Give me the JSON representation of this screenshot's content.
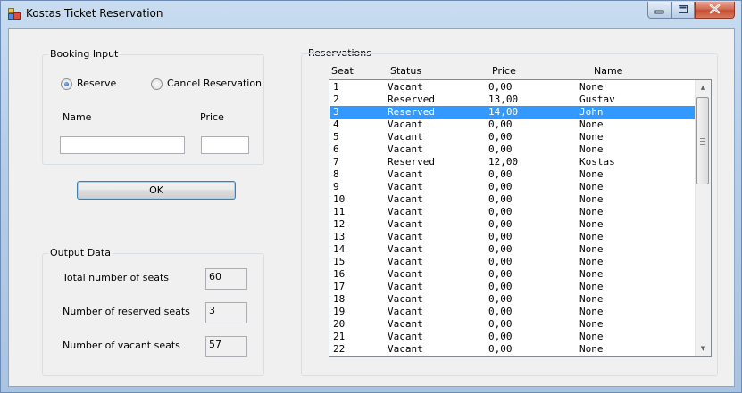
{
  "window": {
    "title": "Kostas Ticket Reservation"
  },
  "booking": {
    "group_title": "Booking Input",
    "reserve_label": "Reserve",
    "cancel_label": "Cancel Reservation",
    "selected_option": "Reserve",
    "name_label": "Name",
    "price_label": "Price",
    "name_value": "",
    "price_value": ""
  },
  "ok_label": "OK",
  "output": {
    "group_title": "Output Data",
    "total_label": "Total number of seats",
    "total_value": "60",
    "reserved_label": "Number of reserved seats",
    "reserved_value": "3",
    "vacant_label": "Number of vacant seats",
    "vacant_value": "57"
  },
  "reservations": {
    "group_title": "Reservations",
    "columns": [
      "Seat",
      "Status",
      "Price",
      "Name"
    ],
    "selected_seat": "3",
    "rows": [
      {
        "seat": "1",
        "status": "Vacant",
        "price": "0,00",
        "name": "None"
      },
      {
        "seat": "2",
        "status": "Reserved",
        "price": "13,00",
        "name": "Gustav"
      },
      {
        "seat": "3",
        "status": "Reserved",
        "price": "14,00",
        "name": "John"
      },
      {
        "seat": "4",
        "status": "Vacant",
        "price": "0,00",
        "name": "None"
      },
      {
        "seat": "5",
        "status": "Vacant",
        "price": "0,00",
        "name": "None"
      },
      {
        "seat": "6",
        "status": "Vacant",
        "price": "0,00",
        "name": "None"
      },
      {
        "seat": "7",
        "status": "Reserved",
        "price": "12,00",
        "name": "Kostas"
      },
      {
        "seat": "8",
        "status": "Vacant",
        "price": "0,00",
        "name": "None"
      },
      {
        "seat": "9",
        "status": "Vacant",
        "price": "0,00",
        "name": "None"
      },
      {
        "seat": "10",
        "status": "Vacant",
        "price": "0,00",
        "name": "None"
      },
      {
        "seat": "11",
        "status": "Vacant",
        "price": "0,00",
        "name": "None"
      },
      {
        "seat": "12",
        "status": "Vacant",
        "price": "0,00",
        "name": "None"
      },
      {
        "seat": "13",
        "status": "Vacant",
        "price": "0,00",
        "name": "None"
      },
      {
        "seat": "14",
        "status": "Vacant",
        "price": "0,00",
        "name": "None"
      },
      {
        "seat": "15",
        "status": "Vacant",
        "price": "0,00",
        "name": "None"
      },
      {
        "seat": "16",
        "status": "Vacant",
        "price": "0,00",
        "name": "None"
      },
      {
        "seat": "17",
        "status": "Vacant",
        "price": "0,00",
        "name": "None"
      },
      {
        "seat": "18",
        "status": "Vacant",
        "price": "0,00",
        "name": "None"
      },
      {
        "seat": "19",
        "status": "Vacant",
        "price": "0,00",
        "name": "None"
      },
      {
        "seat": "20",
        "status": "Vacant",
        "price": "0,00",
        "name": "None"
      },
      {
        "seat": "21",
        "status": "Vacant",
        "price": "0,00",
        "name": "None"
      },
      {
        "seat": "22",
        "status": "Vacant",
        "price": "0,00",
        "name": "None"
      }
    ]
  },
  "colors": {
    "selection": "#3399ff",
    "close_button": "#c74d31"
  }
}
